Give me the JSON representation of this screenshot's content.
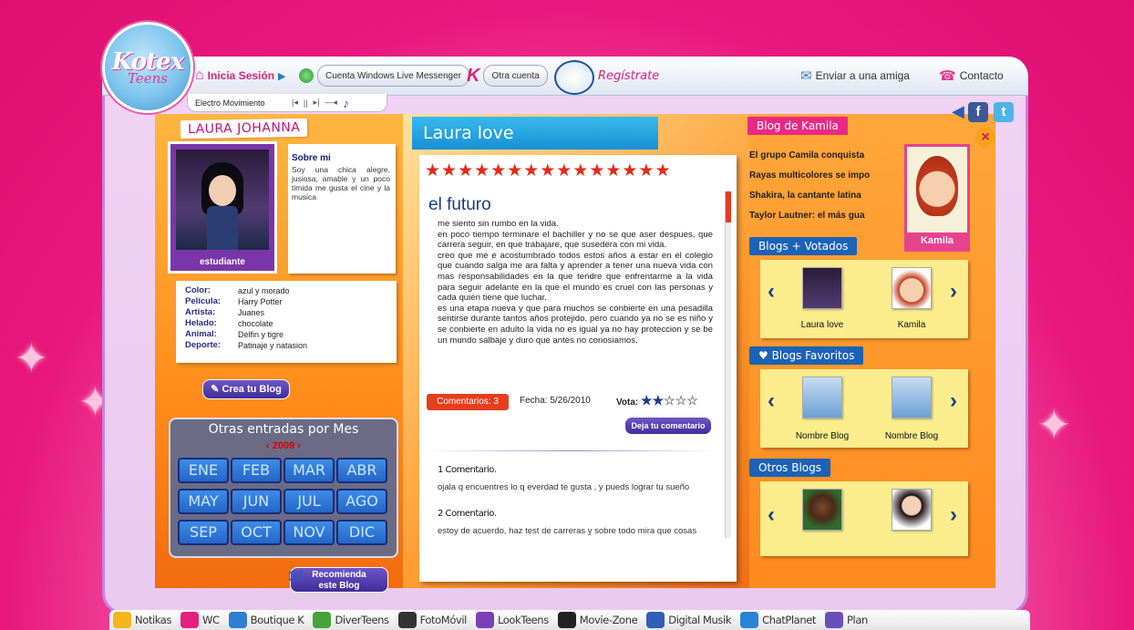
{
  "header": {
    "logo_line1": "Kotex",
    "logo_line2": "Teens",
    "login": "Inicia Sesión",
    "messenger": "Cuenta Windows Live Messenger",
    "other_account": "Otra cuenta",
    "register": "Regístrate",
    "send_friend": "Enviar a una amiga",
    "contact": "Contacto"
  },
  "player": {
    "track": "Electro Movimiento",
    "prev": "|◂",
    "pause": "||",
    "next": "▸|",
    "volume": "—◂"
  },
  "profile": {
    "name": "LAURA JOHANNA",
    "role": "estudiante",
    "about_title": "Sobre mi",
    "about_text": "Soy una chica alegre, jusiosa, amable y un poco timida me gusta el cine y la musica",
    "favorites": [
      {
        "k": "Color:",
        "v": "azul y morado"
      },
      {
        "k": "Película:",
        "v": "Harry Potter"
      },
      {
        "k": "Artista:",
        "v": "Juanes"
      },
      {
        "k": "Helado:",
        "v": "chocolate"
      },
      {
        "k": "Animal:",
        "v": "Delfin y tigre"
      },
      {
        "k": "Deporte:",
        "v": "Patinaje y natasion"
      }
    ],
    "create_blog": "Crea tu Blog",
    "recommend_1": "Recomienda",
    "recommend_2": "este Blog"
  },
  "calendar": {
    "title": "Otras entradas por Mes",
    "year": "2009",
    "prev": "‹",
    "next": "›",
    "months": [
      "ENE",
      "FEB",
      "MAR",
      "ABR",
      "MAY",
      "JUN",
      "JUL",
      "AGO",
      "SEP",
      "OCT",
      "NOV",
      "DIC"
    ]
  },
  "post": {
    "blog_title": "Laura love",
    "stars": "★★★★★★★★★★★★★★★",
    "title": "el futuro",
    "body": "me siento sin rumbo en la vida.\nen poco tiempo terminare el bachiller y no se que aser despues, que carrera seguir, en que trabajare, que susedera con mi vida.\ncreo que me e acostumbrado todos estos años a estar en el colegio que cuando salga me ara falta y aprender a tener una nueva vida con mas responsabilidades en la que tendre que enfrentarme a la vida para seguir adelante en la que el mundo es cruel con las personas y cada quien tiene que luchar.\nes una etapa nueva y que para muchos se conbierte en una pesadilla sentirse durante tantos años protejido. pero cuando ya no se es niño y se conbierte en adulto la vida no es igual ya no hay proteccion y se be un mundo salbaje y duro que antes no conosiamos.",
    "comments_badge": "Comentarios: 3",
    "date": "Fecha: 5/26/2010",
    "vote_label": "Vota:",
    "vote_filled": "★★",
    "vote_empty": "☆☆☆",
    "leave_comment": "Deja tu comentario",
    "comments": [
      {
        "title": "1 Comentario.",
        "text": "ojala q encuentres lo q everdad te gusta , y pueds  lograr tu sueño"
      },
      {
        "title": "2 Comentario.",
        "text": "estoy de acuerdo, haz test de carreras y sobre todo mira que cosas"
      }
    ]
  },
  "sidebar": {
    "blog_of": "Blog de Kamila",
    "headlines": [
      "El grupo Camila conquista",
      "Rayas multicolores se impo",
      "Shakira, la cantante latina",
      "Taylor Lautner: el más gua"
    ],
    "kamila_label": "Kamila",
    "most_voted": "Blogs + Votados",
    "most_voted_items": [
      "Laura love",
      "Kamila"
    ],
    "favorites": "Blogs Favoritos",
    "favorites_items": [
      "Nombre Blog",
      "Nombre Blog"
    ],
    "others": "Otros Blogs",
    "left_arrow": "‹",
    "right_arrow": "›"
  },
  "social": {
    "facebook": "f",
    "twitter": "t"
  },
  "bottom_nav": [
    "Notikas",
    "WC",
    "Boutique K",
    "DiverTeens",
    "FotoMóvil",
    "LookTeens",
    "Movie-Zone",
    "Digital Musik",
    "ChatPlanet",
    "Plan"
  ],
  "colors": {
    "pink": "#e8187d",
    "orange": "#ff8c1a",
    "blue": "#1c62b7",
    "red": "#e52a19"
  }
}
